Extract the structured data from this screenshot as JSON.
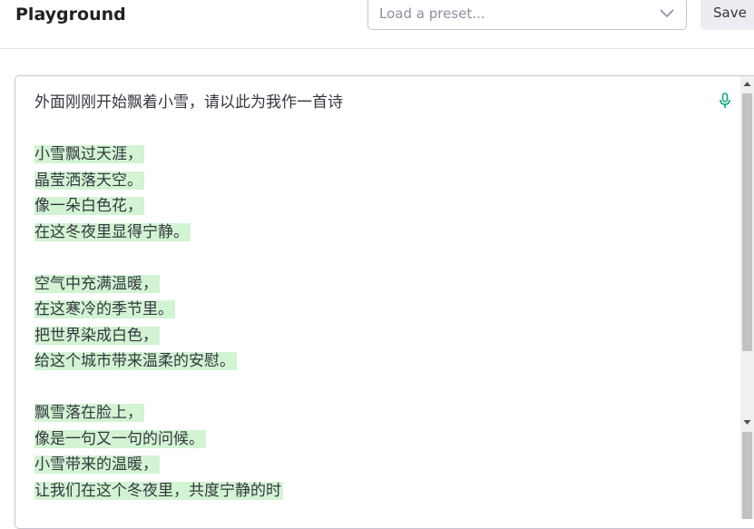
{
  "header": {
    "title": "Playground",
    "preset_placeholder": "Load a preset...",
    "save_label": "Save"
  },
  "editor": {
    "prompt": "外面刚刚开始飘着小雪，请以此为我作一首诗",
    "stanzas": [
      [
        "小雪飘过天涯，",
        "晶莹洒落天空。",
        "像一朵白色花，",
        "在这冬夜里显得宁静。"
      ],
      [
        "空气中充满温暖，",
        "在这寒冷的季节里。",
        "把世界染成白色，",
        "给这个城市带来温柔的安慰。"
      ],
      [
        "飘雪落在脸上，",
        "像是一句又一句的问候。",
        "小雪带来的温暖，",
        "让我们在这个冬夜里，共度宁静的时"
      ]
    ],
    "highlight_color": "#d2f4d3",
    "mic_icon": "microphone-icon"
  },
  "colors": {
    "accent": "#10a37f"
  }
}
